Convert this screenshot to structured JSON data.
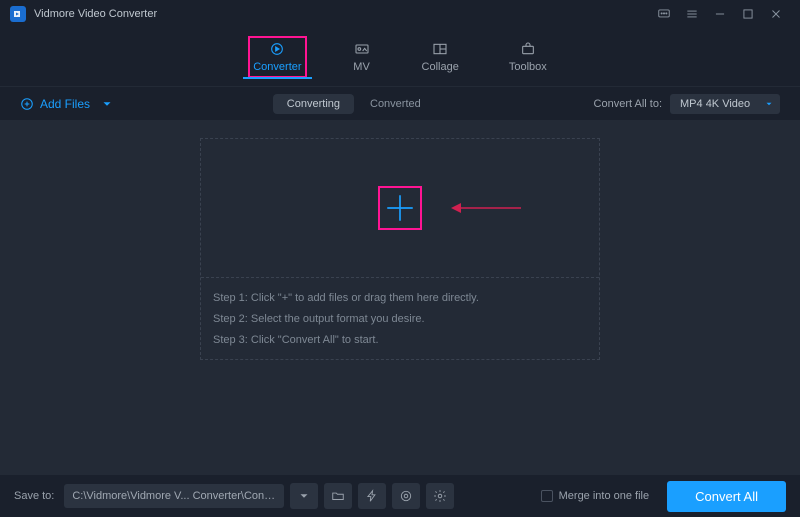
{
  "app": {
    "title": "Vidmore Video Converter"
  },
  "tabs": {
    "converter": "Converter",
    "mv": "MV",
    "collage": "Collage",
    "toolbox": "Toolbox"
  },
  "toolbar": {
    "add_files": "Add Files",
    "status_converting": "Converting",
    "status_converted": "Converted",
    "convert_all_to_label": "Convert All to:",
    "format_selected": "MP4 4K Video"
  },
  "steps": {
    "s1": "Step 1: Click \"+\" to add files or drag them here directly.",
    "s2": "Step 2: Select the output format you desire.",
    "s3": "Step 3: Click \"Convert All\" to start."
  },
  "bottom": {
    "save_to_label": "Save to:",
    "save_path": "C:\\Vidmore\\Vidmore V... Converter\\Converted",
    "merge_label": "Merge into one file",
    "convert_all": "Convert All"
  }
}
